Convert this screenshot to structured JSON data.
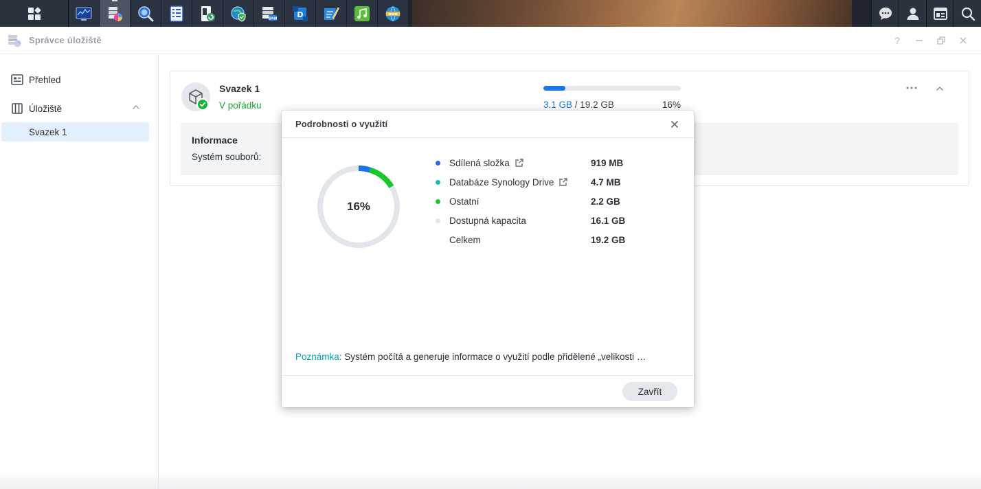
{
  "taskbar": {
    "apps": [
      {
        "icon": "resource-monitor-icon",
        "color": "#1c3f94"
      },
      {
        "icon": "storage-manager-icon",
        "color": "#e84a8a",
        "active": true
      },
      {
        "icon": "universal-search-icon",
        "color": "#2d6fd6"
      },
      {
        "icon": "log-center-icon",
        "color": "#2a5bc2"
      },
      {
        "icon": "hyper-backup-icon",
        "color": "#3a9a6b"
      },
      {
        "icon": "security-advisor-icon",
        "color": "#1e88c9"
      },
      {
        "icon": "san-manager-icon",
        "color": "#4a5666"
      },
      {
        "icon": "synology-drive-icon",
        "color": "#1f7ee0"
      },
      {
        "icon": "text-editor-icon",
        "color": "#2a8ae0"
      },
      {
        "icon": "audio-station-icon",
        "color": "#5bbf3a"
      },
      {
        "icon": "web-station-icon",
        "color": "#1f8fe0"
      }
    ],
    "right_icons": [
      "chat-icon",
      "user-icon",
      "widgets-icon",
      "search-icon"
    ]
  },
  "window": {
    "title": "Správce úložiště"
  },
  "sidebar": {
    "overview": "Přehled",
    "storage": "Úložiště",
    "volume": "Svazek 1"
  },
  "volume": {
    "name": "Svazek 1",
    "status": "V pořádku",
    "used": "3.1 GB",
    "separator": " / ",
    "total": "19.2 GB",
    "percent": "16%",
    "usage_fraction": 0.16,
    "info_title": "Informace",
    "filesystem_label": "Systém souborů:"
  },
  "modal": {
    "title": "Podrobnosti o využití",
    "center_percent": "16%",
    "items": [
      {
        "label": "Sdílená složka",
        "value": "919 MB",
        "color": "#1a73e8",
        "external": true
      },
      {
        "label": "Databáze Synology Drive",
        "value": "4.7 MB",
        "color": "#17b9c9",
        "external": true
      },
      {
        "label": "Ostatní",
        "value": "2.2 GB",
        "color": "#1bc62b",
        "external": false
      },
      {
        "label": "Dostupná kapacita",
        "value": "16.1 GB",
        "color": "#e2e5e9",
        "external": false
      },
      {
        "label": "Celkem",
        "value": "19.2 GB",
        "color": "",
        "external": false
      }
    ],
    "donut": {
      "total_gb": 19.2,
      "segments": [
        {
          "name": "Sdílená složka",
          "gb": 0.919,
          "color": "#1a73e8"
        },
        {
          "name": "Databáze Synology Drive",
          "gb": 0.0047,
          "color": "#17b9c9"
        },
        {
          "name": "Ostatní",
          "gb": 2.2,
          "color": "#1bc62b"
        }
      ],
      "track_color": "#e2e5e9"
    },
    "note_label": "Poznámka:",
    "note_text": " Systém počítá a generuje informace o využití podle přidělené „velikosti …",
    "close_button": "Zavřít"
  }
}
